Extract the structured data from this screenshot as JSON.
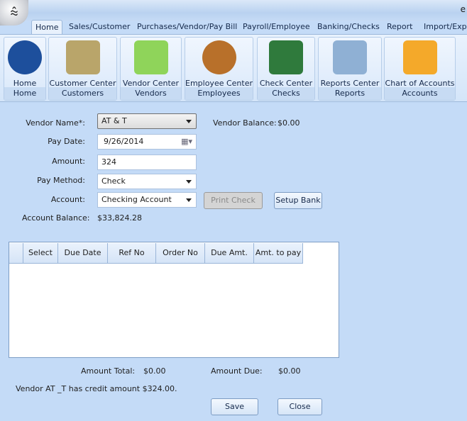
{
  "window": {
    "title_fragment": "e"
  },
  "tabs": [
    "Home",
    "Sales/Customer",
    "Purchases/Vendor/Pay Bill",
    "Payroll/Employee",
    "Banking/Checks",
    "Report",
    "Import/Expo"
  ],
  "ribbon": [
    {
      "label": "Home",
      "group": "Home",
      "icon": "home-icon",
      "color": "#1d4f9c"
    },
    {
      "label": "Customer Center",
      "group": "Customers",
      "icon": "customer-folder-icon",
      "color": "#b9a56a"
    },
    {
      "label": "Vendor Center",
      "group": "Vendors",
      "icon": "vendor-book-icon",
      "color": "#8fd45a"
    },
    {
      "label": "Employee Center",
      "group": "Employees",
      "icon": "employee-group-icon",
      "color": "#b8702a"
    },
    {
      "label": "Check Center",
      "group": "Checks",
      "icon": "checkbook-icon",
      "color": "#2f7a3c"
    },
    {
      "label": "Reports Center",
      "group": "Reports",
      "icon": "reports-binder-icon",
      "color": "#8fb0d4"
    },
    {
      "label": "Chart of Accounts",
      "group": "Accounts",
      "icon": "accounts-folder-icon",
      "color": "#f4a92a"
    }
  ],
  "form": {
    "vendor_label": "Vendor Name*:",
    "vendor_value": "AT & T",
    "vendor_balance_label": "Vendor Balance:",
    "vendor_balance": "$0.00",
    "pay_date_label": "Pay Date:",
    "pay_date": "9/26/2014",
    "amount_label": "Amount:",
    "amount": "324",
    "pay_method_label": "Pay Method:",
    "pay_method": "Check",
    "account_label": "Account:",
    "account": "Checking Account",
    "print_check": "Print Check",
    "setup_bank": "Setup Bank",
    "account_balance_label": "Account Balance:",
    "account_balance": "$33,824.28"
  },
  "grid": {
    "columns": [
      "Select",
      "Due Date",
      "Ref No",
      "Order No",
      "Due Amt.",
      "Amt. to pay"
    ]
  },
  "totals": {
    "amount_total_label": "Amount Total:",
    "amount_total": "$0.00",
    "amount_due_label": "Amount Due:",
    "amount_due": "$0.00"
  },
  "message": "Vendor AT _T has credit amount $324.00.",
  "buttons": {
    "save": "Save",
    "close": "Close"
  }
}
